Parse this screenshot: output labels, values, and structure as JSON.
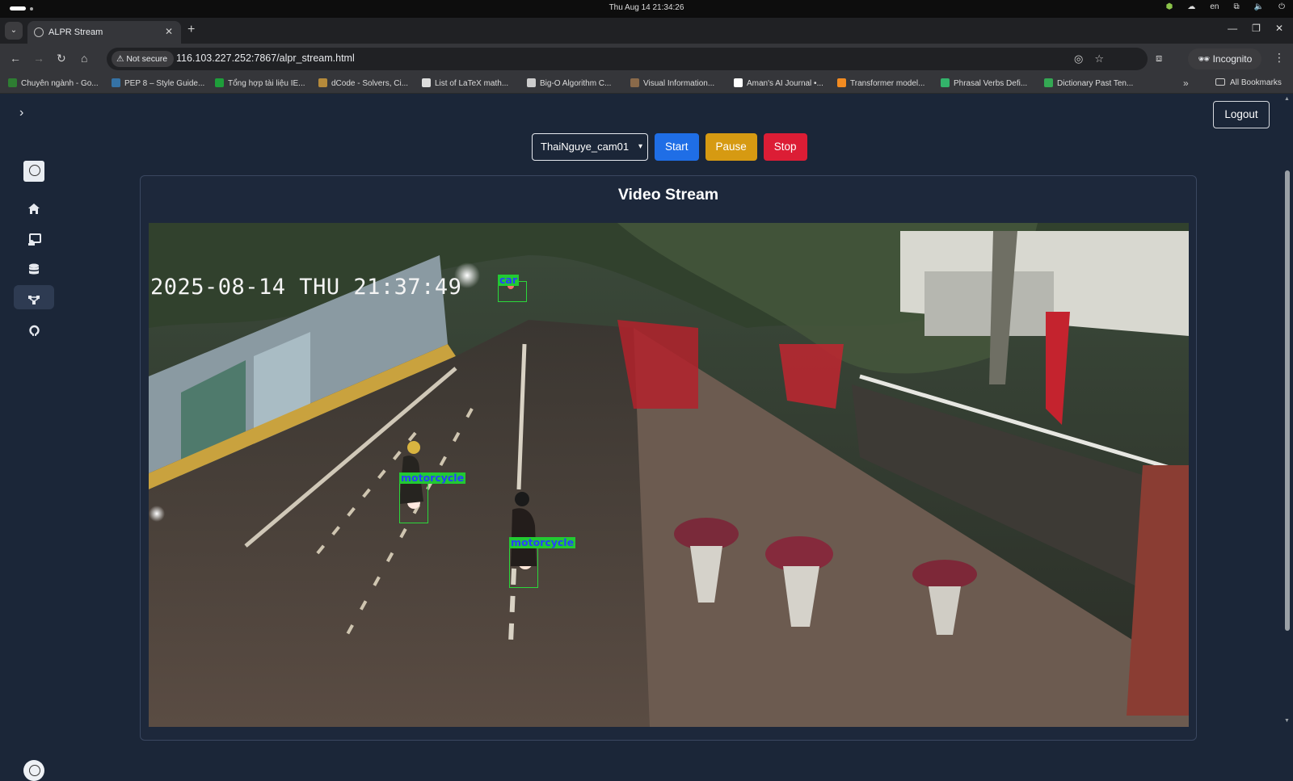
{
  "os": {
    "clock": "Thu Aug 14  21:34:26",
    "lang": "en"
  },
  "browser": {
    "tab_title": "ALPR Stream",
    "not_secure": "Not secure",
    "url": "116.103.227.252:7867/alpr_stream.html",
    "incognito": "Incognito",
    "all_bookmarks": "All Bookmarks"
  },
  "bookmarks": [
    {
      "label": "Chuyên ngành - Go...",
      "color": "#2e7d32"
    },
    {
      "label": "PEP 8 – Style Guide...",
      "color": "#3572A5"
    },
    {
      "label": "Tổng hợp tài liệu IE...",
      "color": "#1e9e3a"
    },
    {
      "label": "dCode - Solvers, Ci...",
      "color": "#b58a3b"
    },
    {
      "label": "List of LaTeX math...",
      "color": "#dddddd"
    },
    {
      "label": "Big-O Algorithm C...",
      "color": "#cccccc"
    },
    {
      "label": "Visual Information...",
      "color": "#8a6a4a"
    },
    {
      "label": "Aman's AI Journal •...",
      "color": "#ffffff"
    },
    {
      "label": "Transformer model...",
      "color": "#f28b21"
    },
    {
      "label": "Phrasal Verbs Defi...",
      "color": "#33b36b"
    },
    {
      "label": "Dictionary Past Ten...",
      "color": "#34a853"
    }
  ],
  "app": {
    "logout_label": "Logout",
    "camera_selected": "ThaiNguye_cam01",
    "start_label": "Start",
    "pause_label": "Pause",
    "stop_label": "Stop",
    "stream_title": "Video Stream",
    "stream_timestamp": "2025-08-14 THU 21:37:49",
    "detections": [
      {
        "label": "car"
      },
      {
        "label": "motorcycle"
      },
      {
        "label": "motorcycle"
      }
    ],
    "sidebar_icons": [
      "home-icon",
      "slides-icon",
      "database-icon",
      "workflow-icon",
      "github-icon"
    ]
  }
}
